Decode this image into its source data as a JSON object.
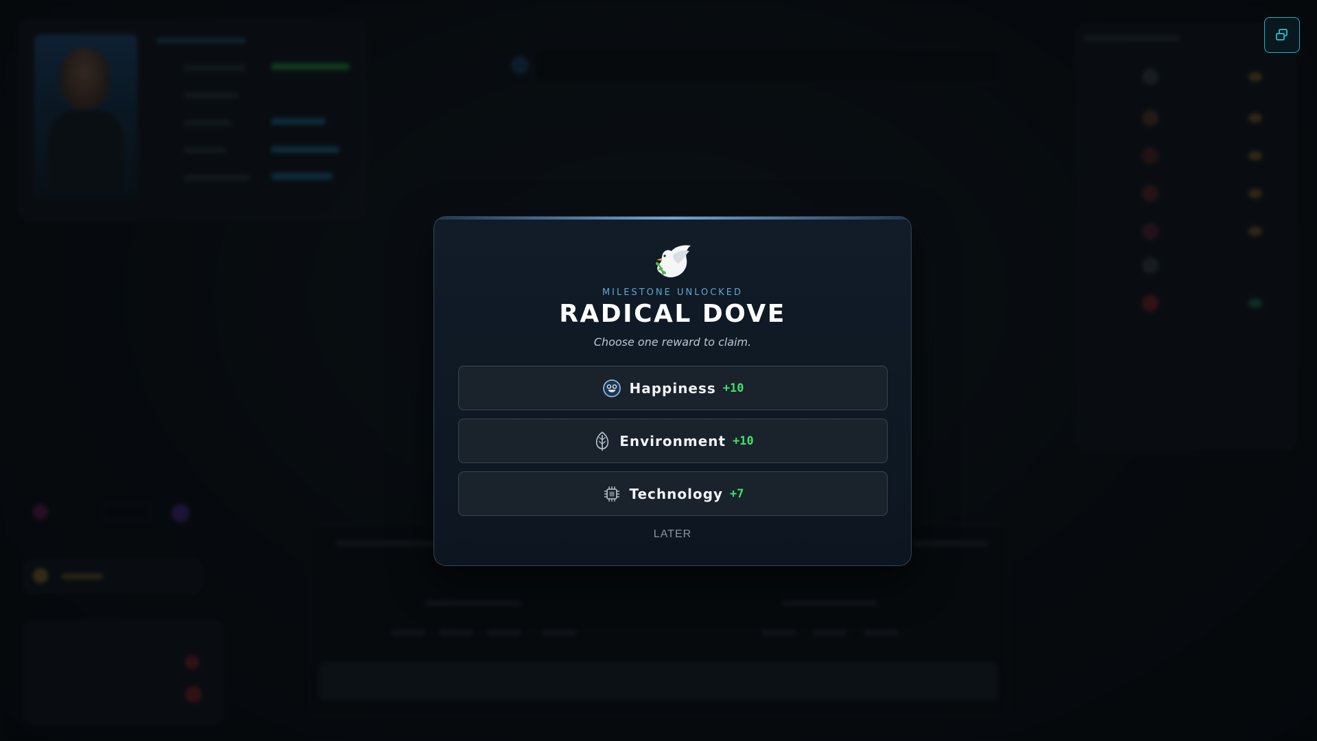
{
  "window_controls": {
    "restore_icon": "restore-window-icon",
    "accent_color": "#1fb3c4"
  },
  "modal": {
    "icon": "dove-icon",
    "subtitle": "MILESTONE UNLOCKED",
    "title": "RADICAL DOVE",
    "instruction": "Choose one reward to claim.",
    "rewards": [
      {
        "label": "Happiness",
        "value": "+10",
        "icon": "happiness-face-icon"
      },
      {
        "label": "Environment",
        "value": "+10",
        "icon": "leaf-icon"
      },
      {
        "label": "Technology",
        "value": "+7",
        "icon": "chip-icon"
      }
    ],
    "later_label": "LATER",
    "colors": {
      "accent": "#5fa6cf",
      "positive_value": "#3ee06a",
      "title": "#ffffff"
    }
  }
}
